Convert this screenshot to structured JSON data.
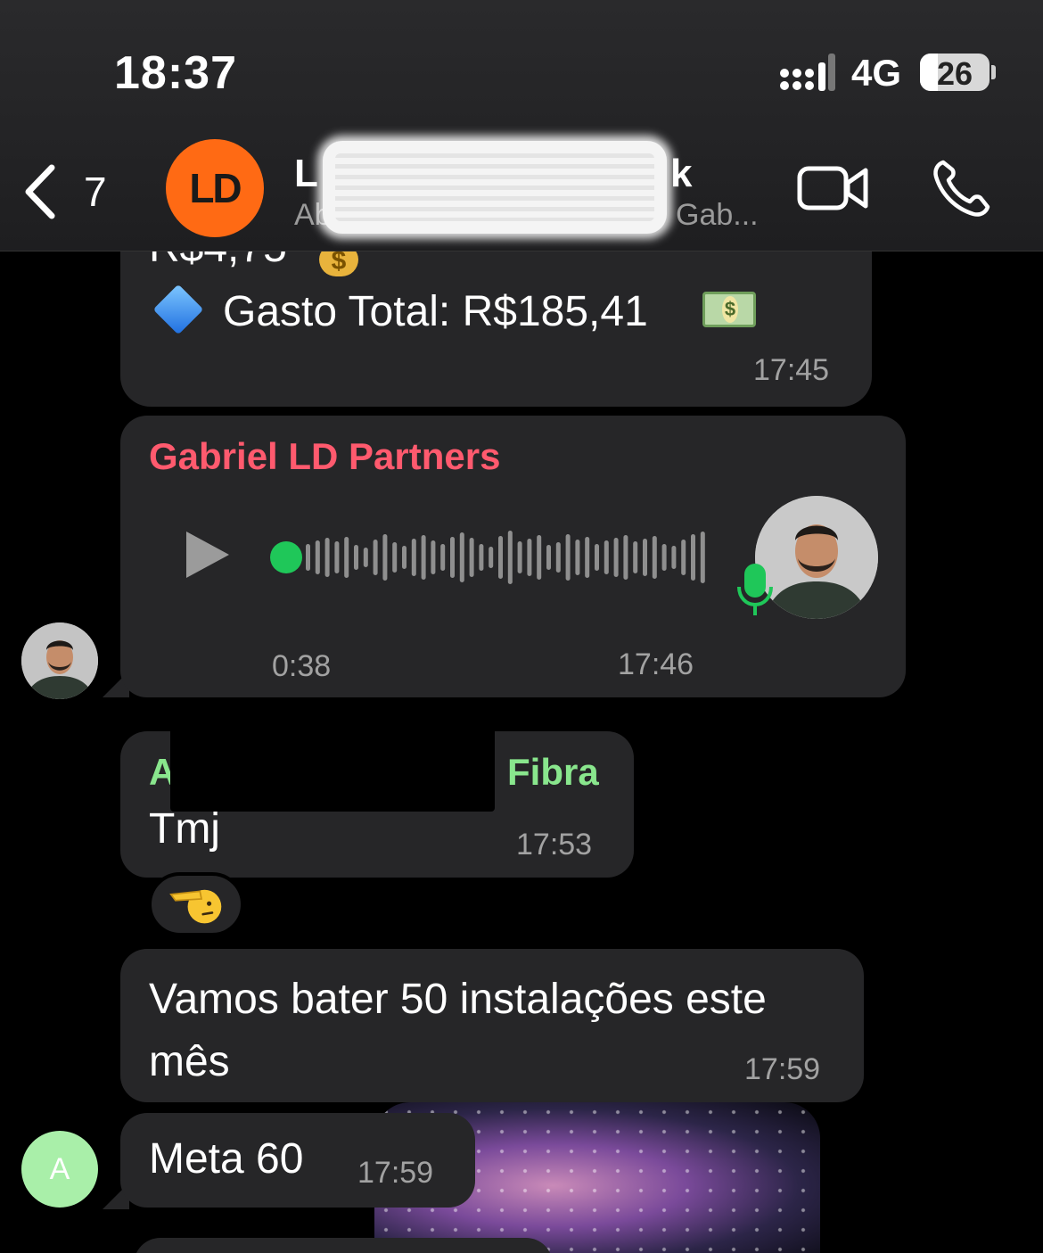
{
  "status_bar": {
    "time": "18:37",
    "network": "4G",
    "battery": "26"
  },
  "header": {
    "back_count": "7",
    "avatar_text": "LD",
    "title_start": "L",
    "title_end": "k",
    "subtitle_start": "Ab",
    "subtitle_end": "Gab...",
    "avatar_color": "#ff6a14"
  },
  "messages": {
    "m1": {
      "partial_line": "R$4,75",
      "total_line": "Gasto Total: R$185,41",
      "time": "17:45"
    },
    "m2": {
      "sender": "Gabriel LD Partners",
      "duration": "0:38",
      "time": "17:46"
    },
    "m3": {
      "sender_start": "A",
      "sender_end": "Fibra",
      "text": "Tmj",
      "time": "17:53",
      "reaction": "saluting-face"
    },
    "m4": {
      "text": "Vamos bater 50 instalações este mês",
      "time": "17:59"
    },
    "m5": {
      "text": "Meta 60",
      "time": "17:59",
      "avatar_letter": "A"
    }
  },
  "colors": {
    "bubble": "#262628",
    "sender_red": "#ff5a6e",
    "sender_green": "#89e68d",
    "accent_green": "#1fc759"
  }
}
